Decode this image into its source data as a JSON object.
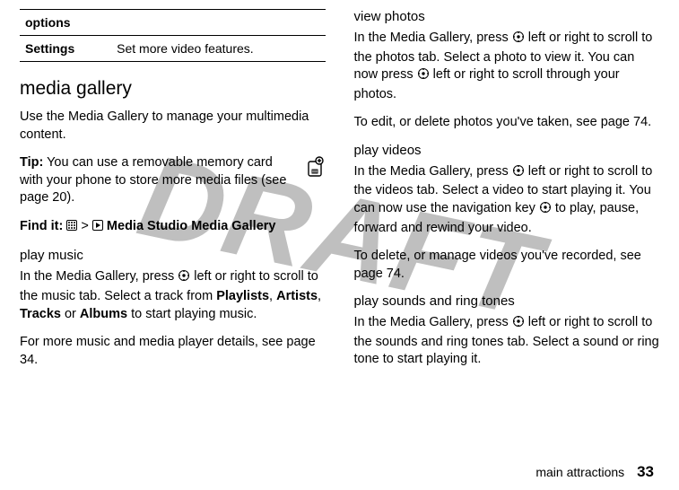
{
  "watermark": "DRAFT",
  "leftCol": {
    "table": {
      "header": "options",
      "row": {
        "label": "Settings",
        "desc": "Set more video features."
      }
    },
    "section": "media gallery",
    "para1": "Use the Media Gallery to manage your multimedia content.",
    "tipLabel": "Tip:",
    "tipText": " You can use a removable memory card with your phone to store more media files (see page 20).",
    "findItLabel": "Find it:",
    "findItPath": " > ",
    "mediaStudio": "Media Studio",
    "mediaGallery": "Media Gallery",
    "playMusicHeading": "play music",
    "playMusicPara": "In the Media Gallery, press ",
    "playMusicPara2": " left or right to scroll to the music tab. Select a track from ",
    "playlists": "Playlists",
    "artists": "Artists",
    "tracks": "Tracks",
    "albums": "Albums",
    "playMusicPara3": " to start playing music.",
    "morePara": "For more music and media player details, see page 34."
  },
  "rightCol": {
    "viewPhotosHeading": "view photos",
    "viewPhotosPara1a": "In the Media Gallery, press ",
    "viewPhotosPara1b": " left or right to scroll to the photos tab. Select a photo to view it. You can now press ",
    "viewPhotosPara1c": " left or right to scroll through your photos.",
    "viewPhotosPara2": "To edit, or delete photos you've taken, see page 74.",
    "playVideosHeading": "play videos",
    "playVideosPara1a": "In the Media Gallery, press ",
    "playVideosPara1b": " left or right to scroll to the videos tab. Select a video to start playing it. You can now use the navigation key ",
    "playVideosPara1c": " to play, pause, forward and rewind your video.",
    "playVideosPara2": "To delete, or manage videos you've recorded, see page 74.",
    "playSoundsHeading": "play sounds and ring tones",
    "playSoundsParaA": "In the Media Gallery, press ",
    "playSoundsParaB": " left or right to scroll to the sounds and ring tones tab. Select a sound or ring tone to start playing it."
  },
  "footer": {
    "label": "main attractions",
    "page": "33"
  },
  "commaSpace": ", ",
  "orWord": " or ",
  "gt": " > "
}
